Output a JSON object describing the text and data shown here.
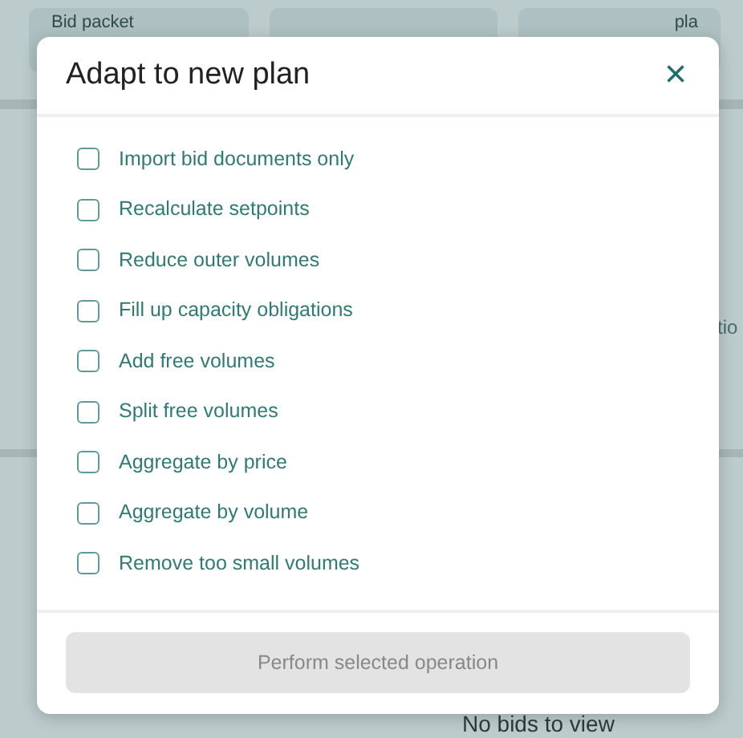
{
  "background": {
    "cards": [
      {
        "label": "Bid packet"
      },
      {
        "label": "pla"
      }
    ],
    "side_text": "tio",
    "empty_message": "No bids to view"
  },
  "dialog": {
    "title": "Adapt to new plan",
    "close": "×",
    "options": [
      {
        "label": "Import bid documents only",
        "checked": false
      },
      {
        "label": "Recalculate setpoints",
        "checked": false
      },
      {
        "label": "Reduce outer volumes",
        "checked": false
      },
      {
        "label": "Fill up capacity obligations",
        "checked": false
      },
      {
        "label": "Add free volumes",
        "checked": false
      },
      {
        "label": "Split free volumes",
        "checked": false
      },
      {
        "label": "Aggregate by price",
        "checked": false
      },
      {
        "label": "Aggregate by volume",
        "checked": false
      },
      {
        "label": "Remove too small volumes",
        "checked": false
      }
    ],
    "submit": {
      "label": "Perform selected operation",
      "disabled": true
    }
  }
}
